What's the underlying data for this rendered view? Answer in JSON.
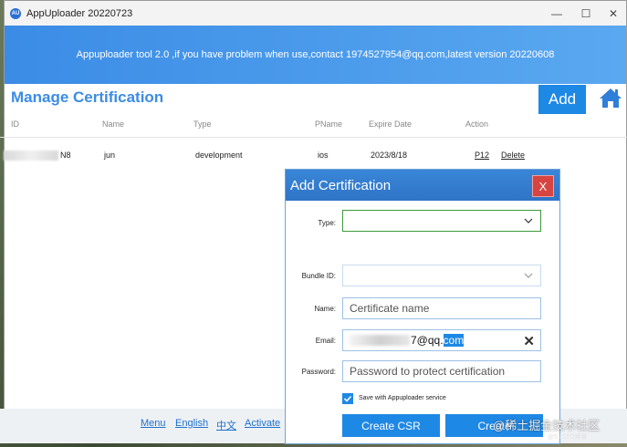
{
  "window": {
    "title": "AppUploader 20220723",
    "app_icon_text": "AU",
    "minimize": "—",
    "maximize": "☐",
    "close": "✕"
  },
  "banner": {
    "text": "Appuploader tool 2.0 ,if you have problem when use,contact 1974527954@qq.com,latest version 20220608"
  },
  "header": {
    "title": "Manage Certification",
    "add_label": "Add",
    "home_icon": "home-icon"
  },
  "table": {
    "columns": [
      "ID",
      "Name",
      "Type",
      "PName",
      "Expire Date",
      "Action"
    ],
    "rows": [
      {
        "id_suffix": "N8",
        "name": "jun",
        "type": "development",
        "pname": "ios",
        "expire": "2023/8/18",
        "action_p12": "P12",
        "action_delete": "Delete"
      }
    ]
  },
  "footer": {
    "links": [
      "Menu",
      "English",
      "中文",
      "Activate"
    ]
  },
  "dialog": {
    "title": "Add Certification",
    "close_label": "X",
    "type_label": "Type:",
    "type_value": "",
    "bundle_label": "Bundle ID:",
    "bundle_value": "",
    "name_label": "Name:",
    "name_placeholder": "Certificate name",
    "email_label": "Email:",
    "email_visible_part": "7@qq.",
    "email_selected_part": "com",
    "password_label": "Password:",
    "password_placeholder": "Password to protect certification",
    "save_checked": true,
    "save_label": "Save with Appuploader service",
    "create_csr_label": "Create CSR",
    "create_label": "Create"
  },
  "watermark": {
    "text": "@稀土掘金技术社区",
    "sub": "@51CTO博客"
  },
  "colors": {
    "accent": "#1e88e5",
    "title_blue": "#3b8ce6",
    "close_red": "#d64541",
    "type_border_green": "#3a9a3a"
  }
}
